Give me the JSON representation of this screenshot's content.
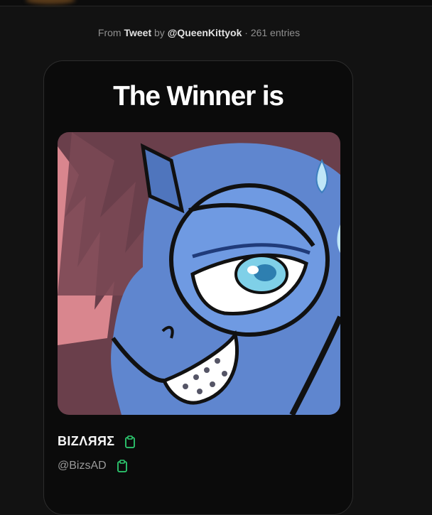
{
  "source": {
    "prefix": "From",
    "type": "Tweet",
    "by": "by",
    "author": "@QueenKittyok",
    "separator": "·",
    "entries": "261 entries"
  },
  "card": {
    "title": "The Winner is"
  },
  "winner": {
    "display_name": "BIZΛЯЯΣ",
    "handle": "@BizsAD"
  },
  "icons": {
    "copy_name": "clipboard-icon",
    "copy_handle": "clipboard-icon"
  },
  "colors": {
    "background": "#121212",
    "card_background": "#0b0b0b",
    "accent_green": "#2ecc71",
    "muted_text": "#8f8f8f"
  }
}
